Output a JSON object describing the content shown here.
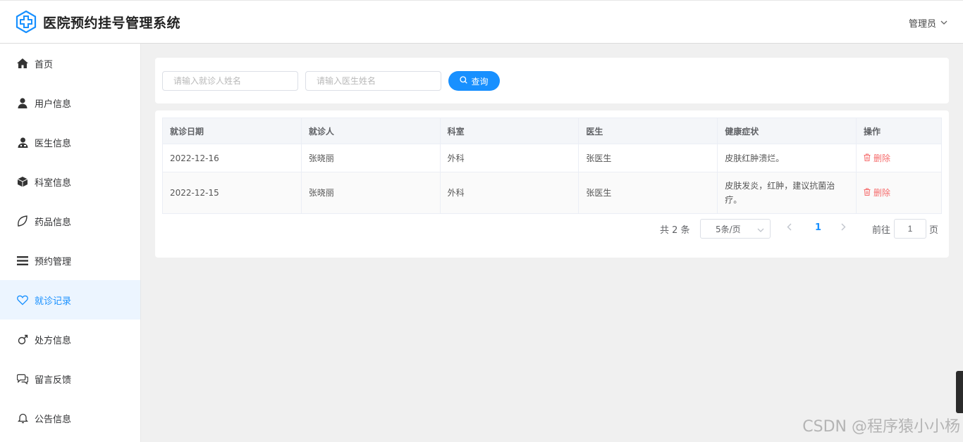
{
  "header": {
    "title": "医院预约挂号管理系统",
    "user": "管理员",
    "logo_icon": "medical-cross-icon",
    "accent": "#1890ff"
  },
  "sidebar": {
    "items": [
      {
        "label": "首页",
        "icon": "home-icon"
      },
      {
        "label": "用户信息",
        "icon": "user-icon"
      },
      {
        "label": "医生信息",
        "icon": "doctor-icon"
      },
      {
        "label": "科室信息",
        "icon": "cube-icon"
      },
      {
        "label": "药品信息",
        "icon": "leaf-icon"
      },
      {
        "label": "预约管理",
        "icon": "menu-icon"
      },
      {
        "label": "就诊记录",
        "icon": "heart-icon",
        "active": true
      },
      {
        "label": "处方信息",
        "icon": "male-icon"
      },
      {
        "label": "留言反馈",
        "icon": "chat-icon"
      },
      {
        "label": "公告信息",
        "icon": "bell-icon"
      }
    ]
  },
  "search": {
    "patient_placeholder": "请输入就诊人姓名",
    "doctor_placeholder": "请输入医生姓名",
    "button_label": "查询"
  },
  "table": {
    "headers": [
      "就诊日期",
      "就诊人",
      "科室",
      "医生",
      "健康症状",
      "操作"
    ],
    "rows": [
      {
        "date": "2022-12-16",
        "patient": "张晓丽",
        "dept": "外科",
        "doctor": "张医生",
        "symptoms": "皮肤红肿溃烂。",
        "action": "删除"
      },
      {
        "date": "2022-12-15",
        "patient": "张晓丽",
        "dept": "外科",
        "doctor": "张医生",
        "symptoms": "皮肤发炎，红肿，建议抗菌治疗。",
        "action": "删除"
      }
    ]
  },
  "pagination": {
    "total": "共 2 条",
    "page_size": "5条/页",
    "current_page": "1",
    "goto_label": "前往",
    "goto_value": "1",
    "page_suffix": "页"
  },
  "watermark": "CSDN @程序猿小小杨"
}
